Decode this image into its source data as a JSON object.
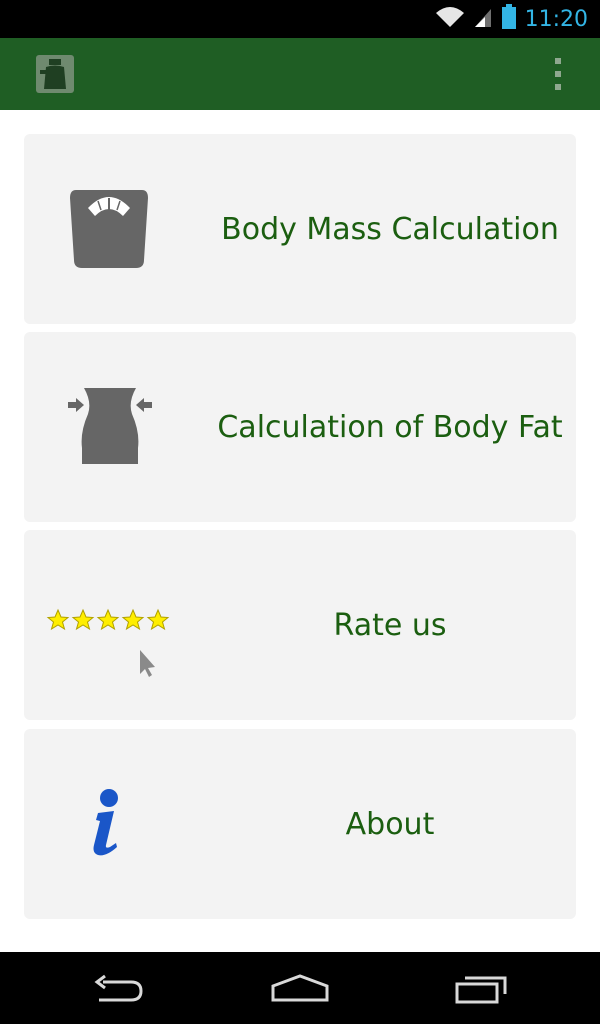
{
  "status_bar": {
    "time": "11:20",
    "icons": [
      "wifi-icon",
      "cell-signal-icon",
      "battery-icon"
    ],
    "color": "#33b5e5"
  },
  "action_bar": {
    "background": "#1f5e24",
    "icons": [
      "app-logo-icon",
      "overflow-menu-icon"
    ]
  },
  "menu": {
    "items": [
      {
        "label": "Body Mass Calculation",
        "icon": "scale-icon"
      },
      {
        "label": "Calculation of Body Fat",
        "icon": "waist-icon"
      },
      {
        "label": "Rate us",
        "icon": "rating-stars-icon"
      },
      {
        "label": "About",
        "icon": "info-icon"
      }
    ],
    "card_color": "#f3f3f3",
    "label_color": "#1b5e10"
  },
  "nav_bar": {
    "icons": [
      "back-icon",
      "home-icon",
      "recent-apps-icon"
    ]
  }
}
